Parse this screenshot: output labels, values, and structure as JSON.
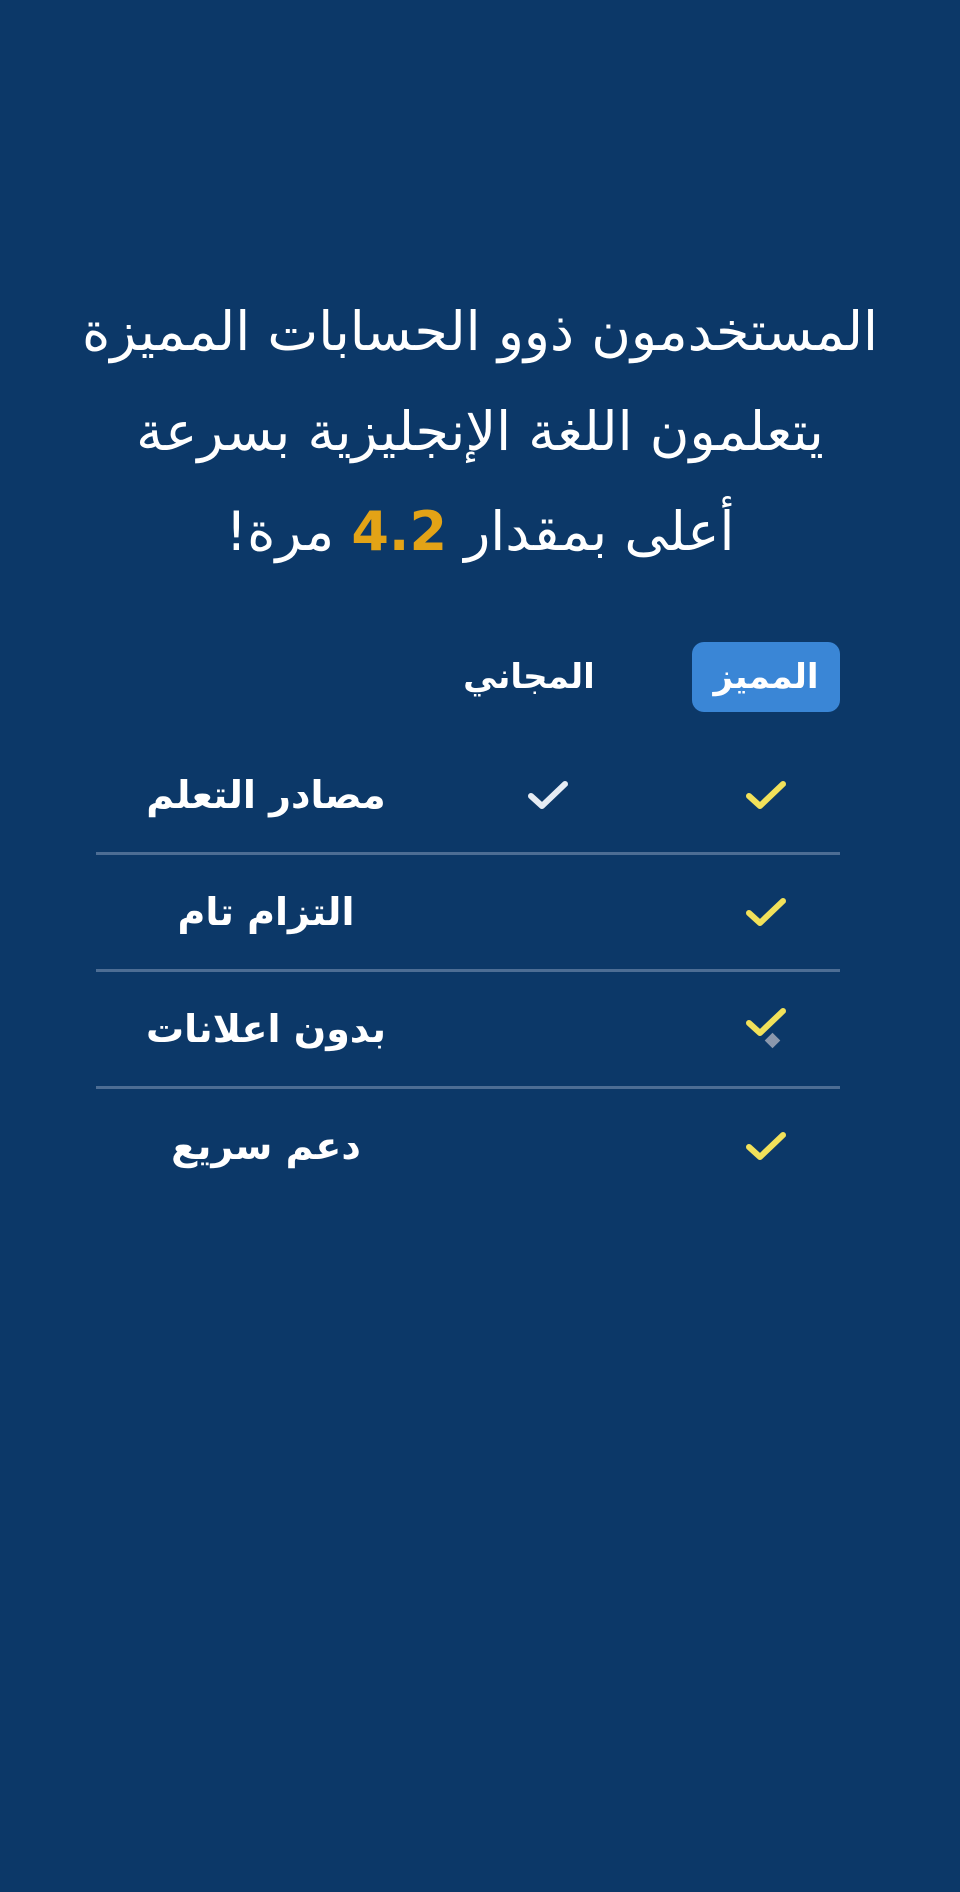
{
  "headline": {
    "line1": "المستخدمون ذوو الحسابات المميزة",
    "line2": "يتعلمون اللغة الإنجليزية بسرعة",
    "line3_before": "أعلى بمقدار ",
    "multiplier": "4.2",
    "line3_after": " مرة!"
  },
  "table": {
    "premium_label": "المميز",
    "free_label": "المجاني",
    "rows": [
      {
        "label": "مصادر التعلم",
        "premium": true,
        "free": true
      },
      {
        "label": "التزام تام",
        "premium": true,
        "free": false
      },
      {
        "label": "بدون اعلانات",
        "premium": true,
        "free": false
      },
      {
        "label": "دعم سريع",
        "premium": true,
        "free": false
      }
    ]
  },
  "colors": {
    "background": "#0c3868",
    "accent": "#e3a316",
    "premium_badge": "#3a86d6",
    "premium_check": "#f2e15a",
    "free_check": "#e6ecf4",
    "divider": "#4d6d94"
  },
  "icons": {
    "premium_check": "check-icon",
    "free_check": "check-icon"
  }
}
